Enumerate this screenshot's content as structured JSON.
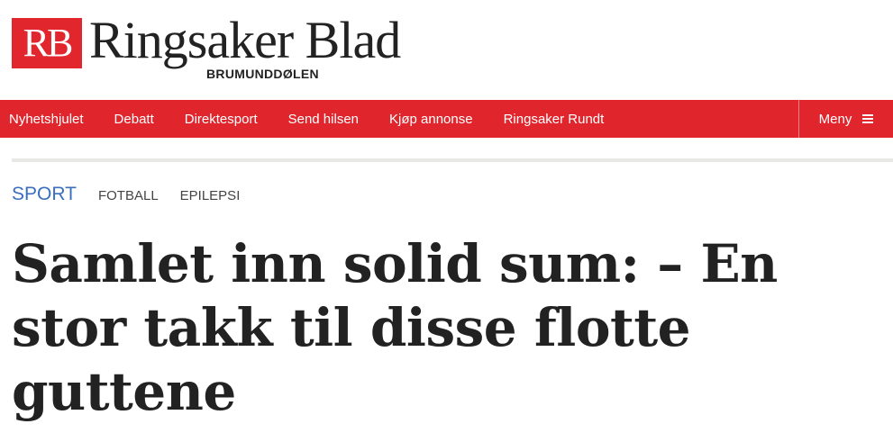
{
  "brand": {
    "mark": "RB",
    "name": "Ringsaker Blad",
    "subtitle": "BRUMUNDDØLEN",
    "color": "#e1252d"
  },
  "nav": {
    "items": [
      {
        "label": "Nyhetshjulet"
      },
      {
        "label": "Debatt"
      },
      {
        "label": "Direktesport"
      },
      {
        "label": "Send hilsen"
      },
      {
        "label": "Kjøp annonse"
      },
      {
        "label": "Ringsaker Rundt"
      }
    ],
    "menu_label": "Meny",
    "menu_icon": "hamburger-icon"
  },
  "article": {
    "section": "SPORT",
    "tags": [
      "FOTBALL",
      "EPILEPSI"
    ],
    "title": "Samlet inn solid sum: – En stor takk til disse flotte guttene",
    "section_color": "#3b6ebf"
  }
}
